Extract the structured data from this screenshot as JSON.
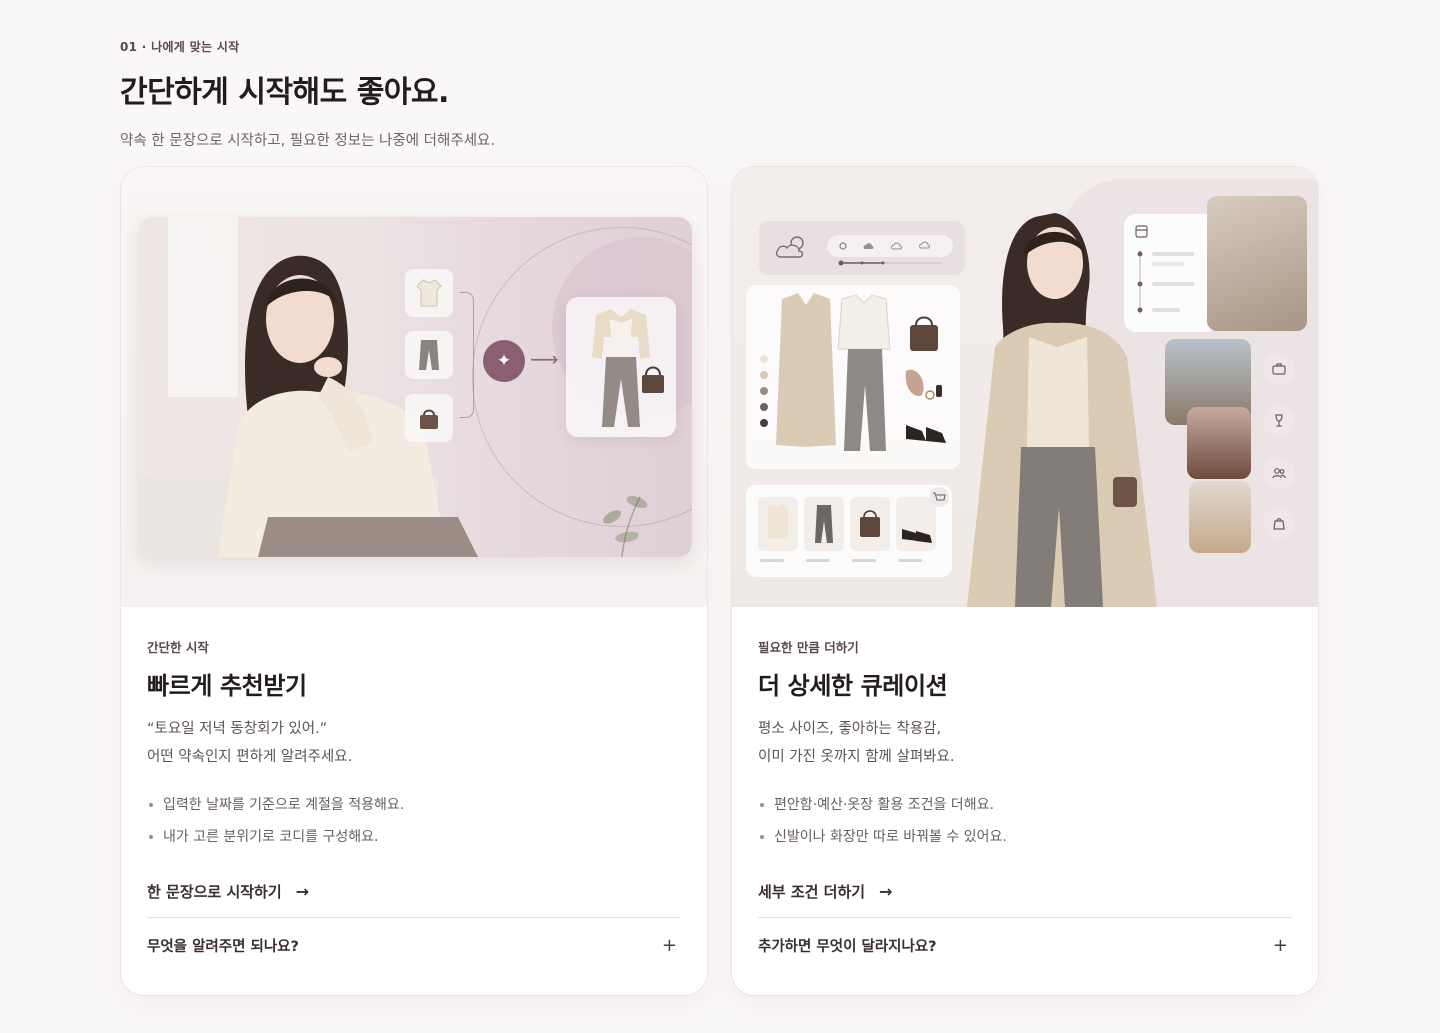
{
  "header": {
    "eyebrow": "01 · 나에게 맞는 시작",
    "title": "간단하게 시작해도 좋아요.",
    "subtitle": "약속 한 문장으로 시작하고, 필요한 정보는 나중에 더해주세요."
  },
  "cards": [
    {
      "eyebrow": "간단한 시작",
      "title": "빠르게 추천받기",
      "desc_line1": "“토요일 저녁 동창회가 있어.”",
      "desc_line2": "어떤 약속인지 편하게 알려주세요.",
      "bullets": [
        "입력한 날짜를 기준으로 계절을 적용해요.",
        "내가 고른 분위기로 코디를 구성해요."
      ],
      "cta_label": "한 문장으로 시작하기",
      "cta_arrow": "→",
      "faq_label": "무엇을 알려주면 되나요?",
      "faq_plus": "+",
      "visual_icons": [
        "shirt-icon",
        "pants-icon",
        "handbag-icon",
        "sparkle-icon"
      ]
    },
    {
      "eyebrow": "필요한 만큼 더하기",
      "title": "더 상세한 큐레이션",
      "desc_line1": "평소 사이즈, 좋아하는 착용감,",
      "desc_line2": "이미 가진 옷까지 함께 살펴봐요.",
      "bullets": [
        "편안함·예산·옷장 활용 조건을 더해요.",
        "신발이나 화장만 따로 바꿔볼 수 있어요."
      ],
      "cta_label": "세부 조건 더하기",
      "cta_arrow": "→",
      "faq_label": "추가하면 무엇이 달라지나요?",
      "faq_plus": "+",
      "visual_icons": [
        "weather-icon",
        "calendar-icon",
        "cart-icon",
        "briefcase-icon",
        "wine-glass-icon",
        "people-icon",
        "shopping-bag-icon"
      ]
    }
  ],
  "colors": {
    "accent": "#8a5f74",
    "background": "#faf7f7",
    "text": "#221b1f"
  }
}
